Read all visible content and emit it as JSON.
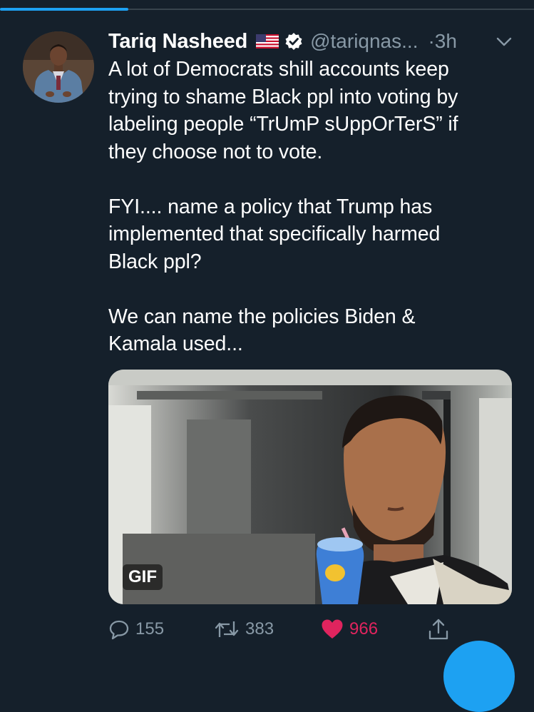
{
  "header_progress": {
    "fraction": 0.24,
    "color": "#1da1f2"
  },
  "tweet": {
    "display_name": "Tariq Nasheed",
    "handle": "@tariqnas...",
    "separator": "·",
    "time": "3h",
    "text": "A lot of Democrats shill accounts keep\ntrying to shame Black ppl into voting by\nlabeling people “TrUmP sUppOrTerS” if\nthey choose not to vote.\n\nFYI.... name a policy that Trump has\nimplemented that specifically harmed\nBlack ppl?\n\nWe can name the policies Biden &\nKamala used...",
    "media": {
      "badge": "GIF"
    },
    "actions": {
      "replies": "155",
      "retweets": "383",
      "likes": "966",
      "liked": true
    }
  },
  "icons": {
    "flag": "us-flag-icon",
    "verified": "verified-badge-icon",
    "caret": "chevron-down-icon",
    "reply": "reply-icon",
    "retweet": "retweet-icon",
    "like": "heart-icon",
    "share": "share-icon"
  },
  "colors": {
    "background": "#15202b",
    "text": "#ffffff",
    "muted": "#8899a6",
    "accent": "#1da1f2",
    "like": "#e0245e"
  }
}
